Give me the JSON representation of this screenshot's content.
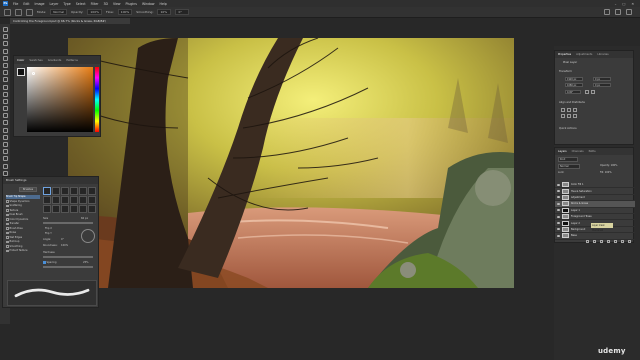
{
  "app": {
    "name": "Ps"
  },
  "menu": [
    "File",
    "Edit",
    "Image",
    "Layer",
    "Type",
    "Select",
    "Filter",
    "3D",
    "View",
    "Plugins",
    "Window",
    "Help"
  ],
  "options": {
    "mode_label": "Mode:",
    "mode": "Normal",
    "opacity_label": "Opacity:",
    "opacity": "100%",
    "flow_label": "Flow:",
    "flow": "100%",
    "smoothing_label": "Smoothing:",
    "smoothing": "10%",
    "angle": "0°"
  },
  "document": {
    "tab_title": "Controlling the Foreground.psd @ 66.7% (Rocks & Grass, RGB/8#)"
  },
  "color_panel": {
    "tabs": [
      "Color",
      "Swatches",
      "Gradients",
      "Patterns"
    ]
  },
  "brush_panel": {
    "title": "Brush Settings",
    "brushes_button": "Brushes",
    "options": [
      "Brush Tip Shape",
      "Shape Dynamics",
      "Scattering",
      "Texture",
      "Dual Brush",
      "Color Dynamics",
      "Transfer",
      "Brush Pose",
      "Noise",
      "Wet Edges",
      "Build-up",
      "Smoothing",
      "Protect Texture"
    ],
    "selected_option": "Brush Tip Shape",
    "size_label": "Size",
    "size": "60 px",
    "flip_x": "Flip X",
    "flip_y": "Flip Y",
    "angle_label": "Angle:",
    "angle": "0°",
    "roundness_label": "Roundness:",
    "roundness": "100%",
    "hardness_label": "Hardness",
    "spacing_label": "Spacing",
    "spacing": "25%"
  },
  "properties": {
    "tabs": [
      "Properties",
      "Adjustments",
      "Libraries"
    ],
    "type_label": "Pixel Layer",
    "transform_label": "Transform",
    "w": "1920 px",
    "h": "1080 px",
    "x": "0 px",
    "y": "0 px",
    "angle": "0.00°",
    "align_label": "Align and Distribute",
    "quick_label": "Quick Actions"
  },
  "layers": {
    "tabs": [
      "Layers",
      "Channels",
      "Paths"
    ],
    "kind": "Kind",
    "mode": "Normal",
    "opacity_label": "Opacity:",
    "opacity": "100%",
    "fill_label": "Fill:",
    "fill": "100%",
    "lock_label": "Lock:",
    "rows": [
      {
        "name": "Color Fill 1"
      },
      {
        "name": "Hue & Saturation"
      },
      {
        "name": "Adjustment"
      },
      {
        "name": "Rocks & Grass"
      },
      {
        "name": "Layer 1"
      },
      {
        "name": "Foreground Trees"
      },
      {
        "name": "Layer 2"
      },
      {
        "name": "Background"
      },
      {
        "name": "Base"
      }
    ],
    "selected_index": 3,
    "tooltip": "Layer mask thumbnail"
  },
  "watermark": "udemy",
  "colors": {
    "accent": "#1e6fc7",
    "selection": "#4d6b8f"
  }
}
